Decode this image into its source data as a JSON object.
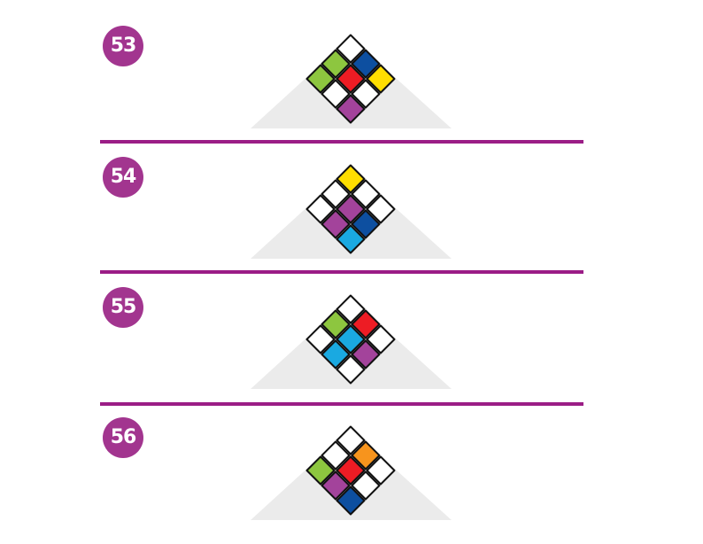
{
  "colors": {
    "badge": "#a2358f",
    "separator": "#9b1d86",
    "base": "#ebebeb",
    "W": "#ffffff",
    "G": "#8dc63f",
    "B": "#0d4fa0",
    "R": "#ed1c24",
    "Y": "#ffde00",
    "P": "#a3439b",
    "C": "#1aa9e1",
    "O": "#f7941d"
  },
  "puzzles": [
    {
      "number": "53",
      "grid": [
        [
          "W",
          "B",
          "Y"
        ],
        [
          "G",
          "R",
          "W"
        ],
        [
          "G",
          "W",
          "P"
        ]
      ]
    },
    {
      "number": "54",
      "grid": [
        [
          "Y",
          "W",
          "W"
        ],
        [
          "W",
          "P",
          "B"
        ],
        [
          "W",
          "P",
          "C"
        ]
      ]
    },
    {
      "number": "55",
      "grid": [
        [
          "W",
          "R",
          "W"
        ],
        [
          "G",
          "C",
          "P"
        ],
        [
          "W",
          "C",
          "W"
        ]
      ]
    },
    {
      "number": "56",
      "grid": [
        [
          "W",
          "O",
          "W"
        ],
        [
          "W",
          "R",
          "W"
        ],
        [
          "G",
          "P",
          "B"
        ]
      ]
    }
  ]
}
